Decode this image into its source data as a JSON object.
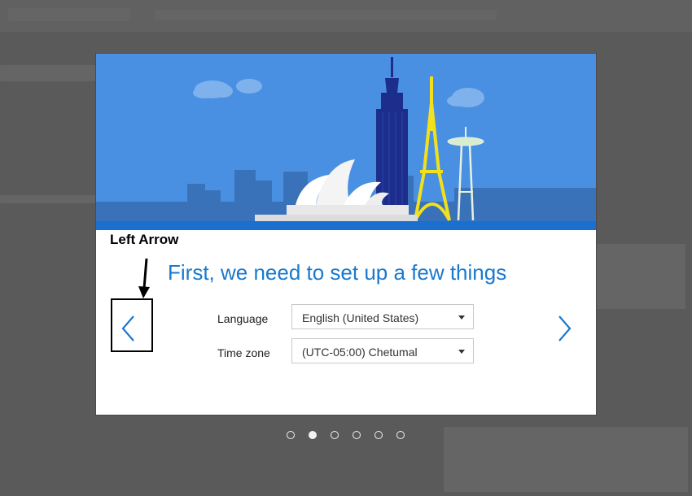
{
  "dialog": {
    "title": "First, we need to set up a few things",
    "language_label": "Language",
    "language_value": "English (United States)",
    "timezone_label": "Time zone",
    "timezone_value": "(UTC-05:00) Chetumal"
  },
  "annotation": {
    "label": "Left Arrow"
  },
  "pagination": {
    "total": 6,
    "active_index": 1
  },
  "colors": {
    "accent": "#1979cf",
    "hero_sky": "#4a90e2",
    "hero_band": "#1a6fd0"
  },
  "icons": {
    "prev": "chevron-left-icon",
    "next": "chevron-right-icon",
    "caret": "caret-down-icon"
  }
}
